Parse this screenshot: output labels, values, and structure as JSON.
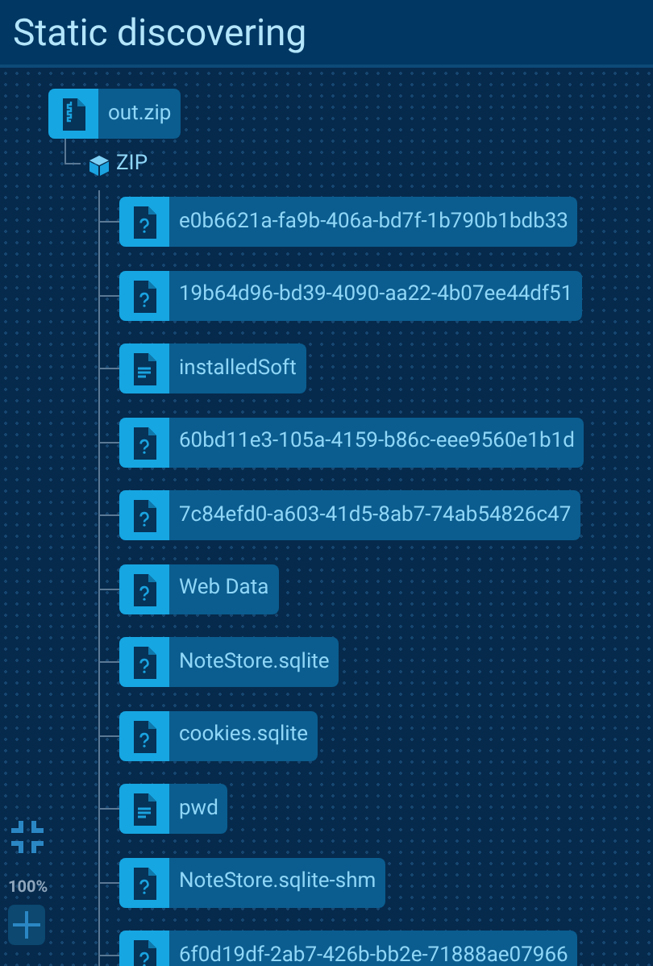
{
  "header": {
    "title": "Static discovering"
  },
  "tree": {
    "label": "out.zip",
    "kind": "archive",
    "children": [
      {
        "label": "ZIP",
        "kind": "container",
        "children": [
          {
            "label": "e0b6621a-fa9b-406a-bd7f-1b790b1bdb33",
            "kind": "unknown"
          },
          {
            "label": "19b64d96-bd39-4090-aa22-4b07ee44df51",
            "kind": "unknown"
          },
          {
            "label": "installedSoft",
            "kind": "text"
          },
          {
            "label": "60bd11e3-105a-4159-b86c-eee9560e1b1d",
            "kind": "unknown"
          },
          {
            "label": "7c84efd0-a603-41d5-8ab7-74ab54826c47",
            "kind": "unknown"
          },
          {
            "label": "Web Data",
            "kind": "unknown"
          },
          {
            "label": "NoteStore.sqlite",
            "kind": "unknown"
          },
          {
            "label": "cookies.sqlite",
            "kind": "unknown"
          },
          {
            "label": "pwd",
            "kind": "text"
          },
          {
            "label": "NoteStore.sqlite-shm",
            "kind": "unknown"
          },
          {
            "label": "6f0d19df-2ab7-426b-bb2e-71888ae07966",
            "kind": "unknown"
          }
        ]
      }
    ]
  },
  "zoom": {
    "level_label": "100%"
  }
}
